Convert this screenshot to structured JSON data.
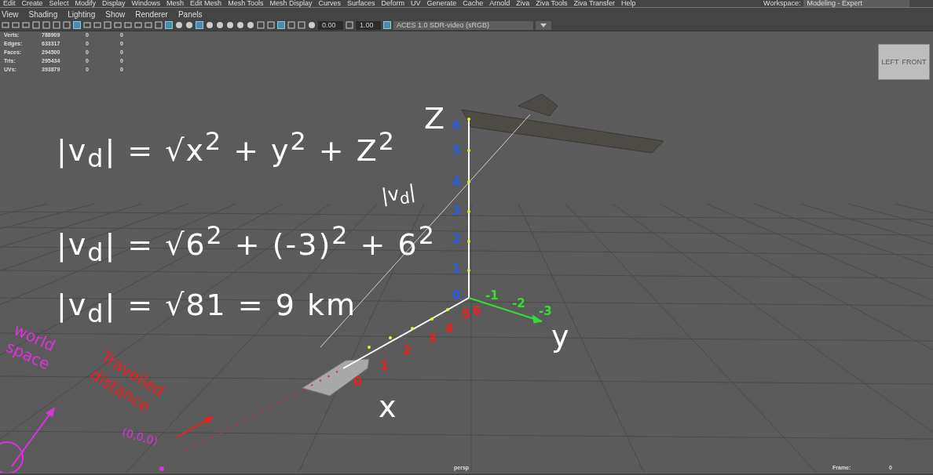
{
  "menu_bar": {
    "items": [
      "Edit",
      "Create",
      "Select",
      "Modify",
      "Display",
      "Windows",
      "Mesh",
      "Edit Mesh",
      "Mesh Tools",
      "Mesh Display",
      "Curves",
      "Surfaces",
      "Deform",
      "UV",
      "Generate",
      "Cache",
      "Arnold",
      "Ziva",
      "Ziva Tools",
      "Ziva Transfer",
      "Help"
    ],
    "workspace_label": "Workspace:",
    "workspace_value": "Modeling - Expert"
  },
  "panel_menu": [
    "View",
    "Shading",
    "Lighting",
    "Show",
    "Renderer",
    "Panels"
  ],
  "toolbar": {
    "exposure": "0.00",
    "gamma": "1.00",
    "color_space": "ACES 1.0 SDR-video (sRGB)"
  },
  "stats": [
    {
      "label": "Verts:",
      "value": "788909",
      "column_2": "0",
      "column_3": "0"
    },
    {
      "label": "Edges:",
      "value": "633317",
      "column_2": "0",
      "column_3": "0"
    },
    {
      "label": "Faces:",
      "value": "294500",
      "column_2": "0",
      "column_3": "0"
    },
    {
      "label": "Tris:",
      "value": "295434",
      "column_2": "0",
      "column_3": "0"
    },
    {
      "label": "UVs:",
      "value": "393879",
      "column_2": "0",
      "column_3": "0"
    }
  ],
  "view_cube": {
    "faces": [
      "LEFT",
      "FRONT"
    ]
  },
  "annotations": {
    "formulas": [
      "|v$_{d}$| = √x$^{2}$ + y$^{2}$ + Z$^{2}$",
      "|v$_{d}$| = √6$^{2}$ + (-3)$^{2}$ + 6$^{2}$",
      "|v$_{d}$| = √81 = 9 km"
    ],
    "vector_label": "|v$_{d}$|",
    "z_label": "Z",
    "y_label": "y",
    "x_label": "x",
    "z_ticks": [
      "6",
      "5",
      "4",
      "3",
      "2",
      "1",
      "0"
    ],
    "y_ticks": [
      "-1",
      "-2",
      "-3"
    ],
    "x_ticks": [
      "0",
      "1",
      "2",
      "3",
      "4",
      "5",
      "6"
    ],
    "world_space": "world space",
    "travelled": "Travelled distance",
    "origin": "(0,0,0)"
  },
  "hud": {
    "camera": "persp",
    "frame_label": "Frame:",
    "frame_value": "0"
  }
}
